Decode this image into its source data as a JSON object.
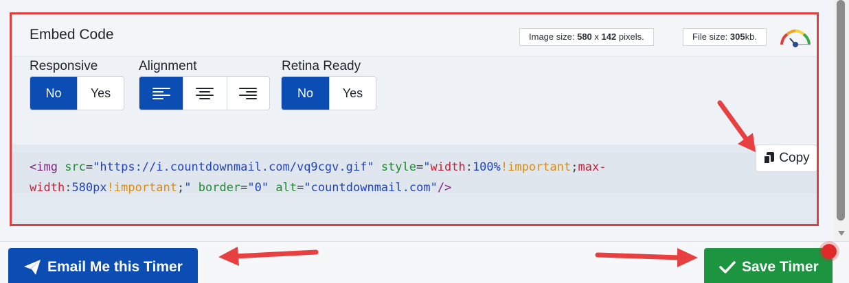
{
  "panel": {
    "title": "Embed Code",
    "image_size": {
      "prefix": "Image size: ",
      "width": "580",
      "sep": " x ",
      "height": "142",
      "suffix": " pixels."
    },
    "file_size": {
      "prefix": "File size: ",
      "value": "305",
      "suffix": "kb."
    },
    "gauge_icon": "speed-gauge-icon"
  },
  "options": {
    "responsive": {
      "label": "Responsive",
      "no": "No",
      "yes": "Yes",
      "selected": "No"
    },
    "alignment": {
      "label": "Alignment",
      "options": [
        "align-left-icon",
        "align-center-icon",
        "align-right-icon"
      ],
      "selected": "align-left-icon"
    },
    "retina": {
      "label": "Retina Ready",
      "no": "No",
      "yes": "Yes",
      "selected": "No"
    }
  },
  "code": {
    "line1": [
      {
        "t": "tag",
        "v": "<img "
      },
      {
        "t": "attr",
        "v": "src"
      },
      {
        "t": "plain",
        "v": "="
      },
      {
        "t": "str",
        "v": "\"https://i.countdownmail.com/vq9cgv.gif\""
      },
      {
        "t": "plain",
        "v": " "
      },
      {
        "t": "attr",
        "v": "style"
      },
      {
        "t": "plain",
        "v": "="
      },
      {
        "t": "str",
        "v": "\""
      },
      {
        "t": "prop",
        "v": "width"
      },
      {
        "t": "plain",
        "v": ":"
      },
      {
        "t": "num",
        "v": "100%"
      },
      {
        "t": "imp",
        "v": "!important"
      },
      {
        "t": "plain",
        "v": ";"
      },
      {
        "t": "prop",
        "v": "max-"
      }
    ],
    "line2": [
      {
        "t": "prop",
        "v": "width"
      },
      {
        "t": "plain",
        "v": ":"
      },
      {
        "t": "num",
        "v": "580px"
      },
      {
        "t": "imp",
        "v": "!important"
      },
      {
        "t": "plain",
        "v": ";"
      },
      {
        "t": "str",
        "v": "\""
      },
      {
        "t": "plain",
        "v": " "
      },
      {
        "t": "attr",
        "v": "border"
      },
      {
        "t": "plain",
        "v": "="
      },
      {
        "t": "str",
        "v": "\"0\""
      },
      {
        "t": "plain",
        "v": " "
      },
      {
        "t": "attr",
        "v": "alt"
      },
      {
        "t": "plain",
        "v": "="
      },
      {
        "t": "str",
        "v": "\"countdownmail.com\""
      },
      {
        "t": "tag",
        "v": "/>"
      }
    ],
    "copy_label": "Copy"
  },
  "footer": {
    "email_label": "Email Me this Timer",
    "save_label": "Save Timer"
  },
  "colors": {
    "primary": "#0b4db3",
    "success": "#1d9440",
    "highlight": "#e03e3e"
  }
}
